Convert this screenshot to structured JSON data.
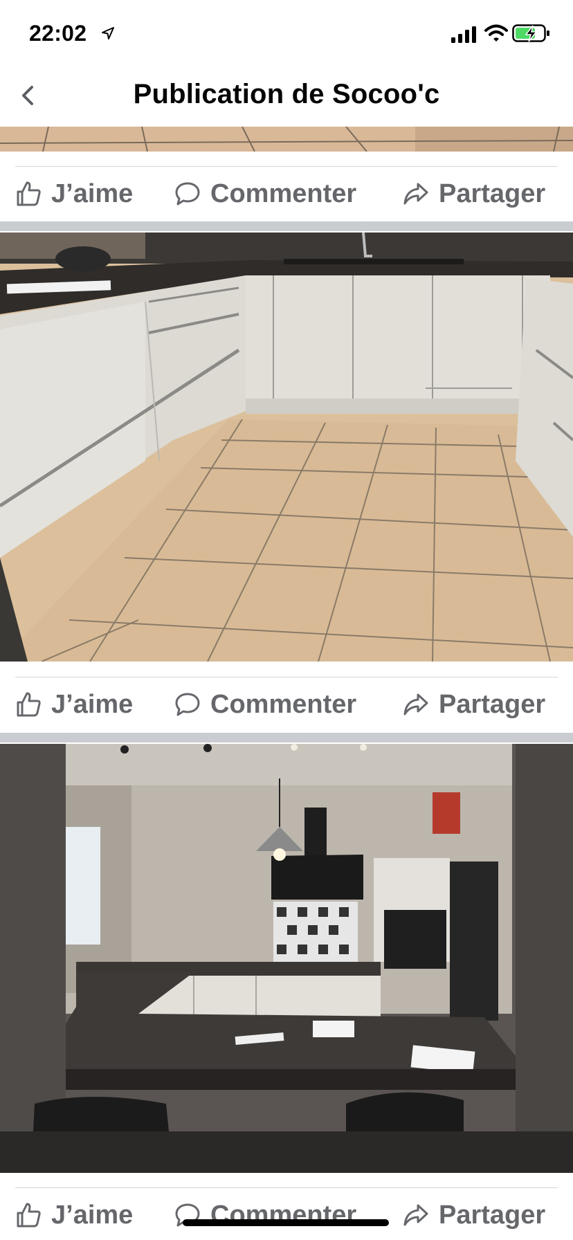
{
  "status_bar": {
    "time": "22:02",
    "icons": [
      "location-arrow-icon",
      "cellular-signal-icon",
      "wifi-icon",
      "battery-charging-icon"
    ]
  },
  "nav": {
    "title": "Publication de Socoo'c",
    "back_icon": "chevron-left-icon"
  },
  "posts": [
    {
      "photo": "kitchen floor (cropped)",
      "actions": {
        "like": "J’aime",
        "comment": "Commenter",
        "share": "Partager"
      }
    },
    {
      "photo": "white handleless kitchen cabinets on tiled floor",
      "actions": {
        "like": "J’aime",
        "comment": "Commenter",
        "share": "Partager"
      }
    },
    {
      "photo": "open kitchen with dark countertop and pendant lamp",
      "actions": {
        "like": "J’aime",
        "comment": "Commenter",
        "share": "Partager"
      }
    }
  ],
  "colors": {
    "action_text": "#65676b",
    "divider": "#d4d6da",
    "post_gap": "#c9ccd1",
    "battery_charge": "#4cd964"
  }
}
